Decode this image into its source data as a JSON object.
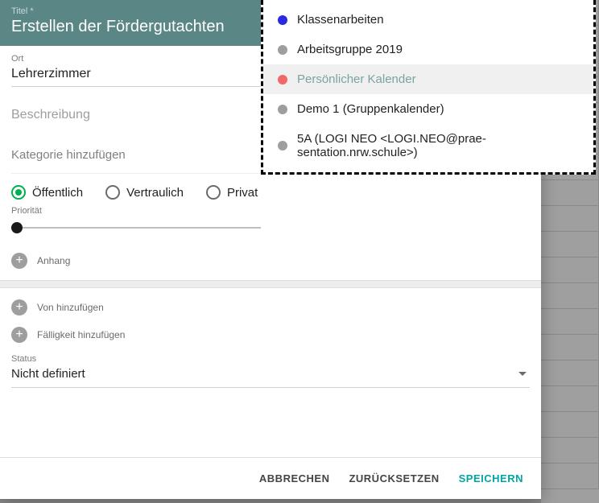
{
  "header": {
    "label": "Titel *",
    "title": "Erstellen der Fördergutachten"
  },
  "ort": {
    "label": "Ort",
    "value": "Lehrerzimmer"
  },
  "beschreibung": {
    "placeholder": "Beschreibung"
  },
  "kategorie": {
    "label": "Kategorie hinzufügen"
  },
  "visibility": {
    "options": [
      {
        "label": "Öffentlich",
        "checked": true
      },
      {
        "label": "Vertraulich",
        "checked": false
      },
      {
        "label": "Privat",
        "checked": false
      }
    ]
  },
  "prio": {
    "label": "Priorität"
  },
  "add": {
    "anhang": "Anhang",
    "von": "Von hinzufügen",
    "faellig": "Fälligkeit hinzufügen"
  },
  "status": {
    "label": "Status",
    "value": "Nicht definiert"
  },
  "footer": {
    "cancel": "ABBRECHEN",
    "reset": "ZURÜCKSETZEN",
    "save": "SPEICHERN"
  },
  "dropdown": {
    "items": [
      {
        "label": "Klassenarbeiten",
        "color": "#2a2ae6",
        "highlight": false
      },
      {
        "label": "Arbeitsgruppe 2019",
        "color": "#9e9e9e",
        "highlight": false
      },
      {
        "label": "Persönlicher Kalender",
        "color": "#f06868",
        "highlight": true
      },
      {
        "label": "Demo 1 (Gruppenkalender)",
        "color": "#9e9e9e",
        "highlight": false
      },
      {
        "label": "5A (LOGI NEO <LOGI.NEO@prae-sentation.nrw.schule>)",
        "color": "#9e9e9e",
        "highlight": false
      }
    ]
  }
}
